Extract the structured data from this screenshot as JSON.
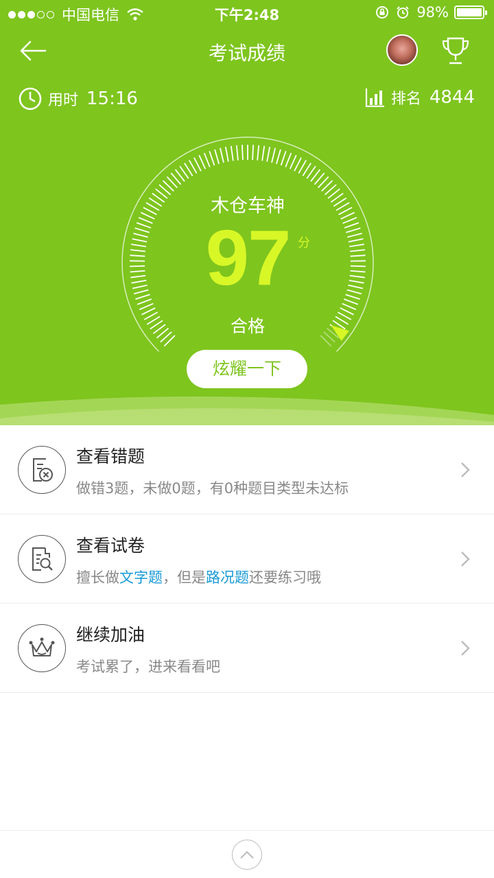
{
  "status_bar": {
    "carrier": "中国电信",
    "time": "下午2:48",
    "battery": "98%"
  },
  "header": {
    "title": "考试成绩",
    "back_icon": "back-arrow-icon",
    "trophy_icon": "trophy-icon"
  },
  "stats": {
    "time_label": "用时",
    "time_value": "15:16",
    "rank_label": "排名",
    "rank_value": "4844"
  },
  "score": {
    "title": "木仓车神",
    "value": "97",
    "unit": "分",
    "result": "合格",
    "share_label": "炫耀一下",
    "fraction": 0.97
  },
  "list": [
    {
      "title": "查看错题",
      "subtitle": "做错3题，未做0题，有0种题目类型未达标",
      "icon": "wrong-answers-icon"
    },
    {
      "title": "查看试卷",
      "sub_prefix": "擅长做",
      "sub_strong": "文字题",
      "sub_middle": "，但是",
      "sub_weak": "路况题",
      "sub_suffix": "还要练习哦",
      "icon": "view-paper-icon"
    },
    {
      "title": "继续加油",
      "subtitle": "考试累了，进来看看吧",
      "icon": "crown-icon"
    }
  ],
  "colors": {
    "brand_green": "#7ec51e",
    "score_yellow": "#d8f727",
    "link_blue": "#1a9ad6"
  }
}
